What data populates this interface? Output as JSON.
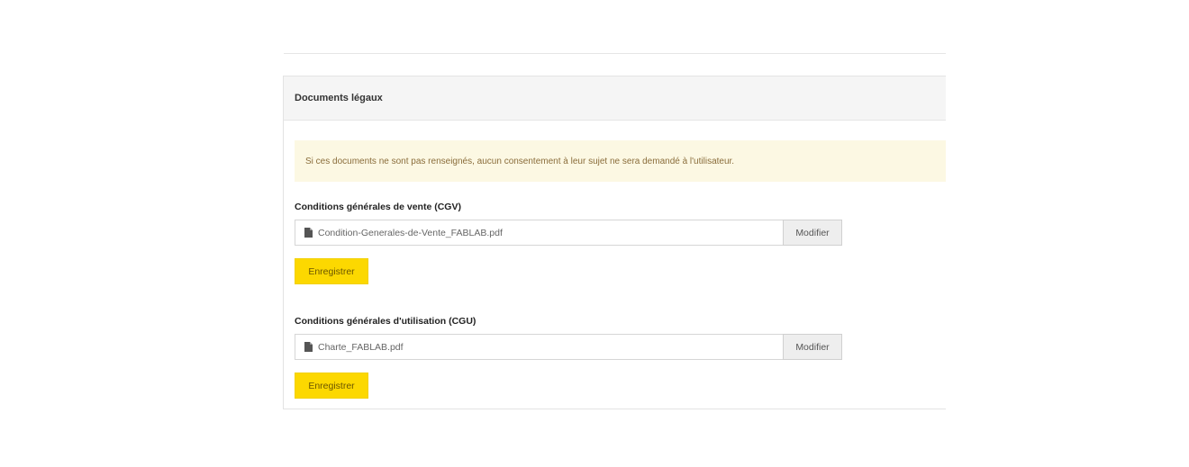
{
  "panel": {
    "title": "Documents légaux",
    "notice": "Si ces documents ne sont pas renseignés, aucun consentement à leur sujet ne sera demandé à l'utilisateur."
  },
  "cgv": {
    "label": "Conditions générales de vente (CGV)",
    "filename": "Condition-Generales-de-Vente_FABLAB.pdf",
    "change_label": "Modifier",
    "save_label": "Enregistrer"
  },
  "cgu": {
    "label": "Conditions générales d'utilisation (CGU)",
    "filename": "Charte_FABLAB.pdf",
    "change_label": "Modifier",
    "save_label": "Enregistrer"
  },
  "colors": {
    "accent": "#fcd800",
    "alert_background": "#fcf8e3",
    "heading_background": "#f5f5f5"
  },
  "icons": {
    "file": "file-icon"
  }
}
